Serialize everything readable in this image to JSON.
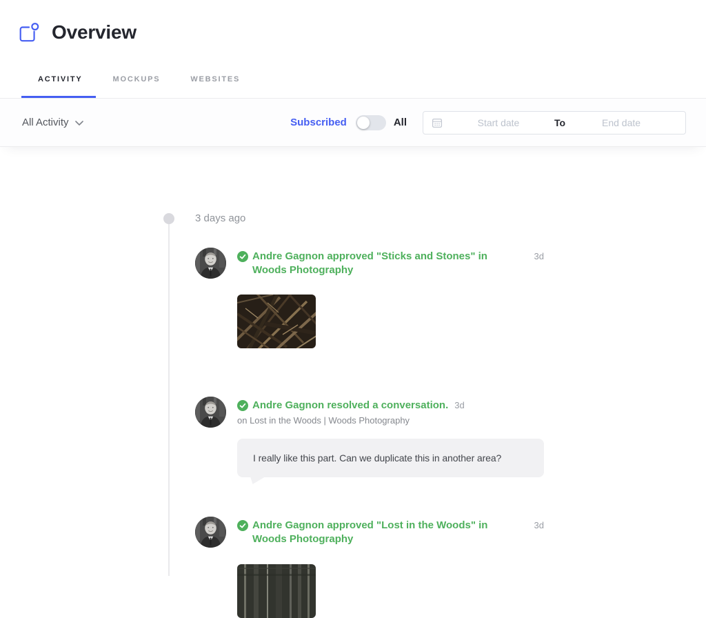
{
  "header": {
    "title": "Overview"
  },
  "tabs": [
    {
      "label": "ACTIVITY",
      "active": true
    },
    {
      "label": "MOCKUPS",
      "active": false
    },
    {
      "label": "WEBSITES",
      "active": false
    }
  ],
  "filter_bar": {
    "activity_filter_label": "All Activity",
    "subscribed_label": "Subscribed",
    "all_label": "All",
    "toggle_position": "left",
    "date_range": {
      "start_placeholder": "Start date",
      "to_label": "To",
      "end_placeholder": "End date"
    }
  },
  "timeline": {
    "group_label": "3 days ago",
    "items": [
      {
        "type": "approval",
        "text": "Andre Gagnon approved \"Sticks and Stones\" in Woods Photography",
        "timestamp": "3d",
        "thumbnail": "sticks-and-stones-photo"
      },
      {
        "type": "conversation-resolved",
        "text": "Andre Gagnon resolved a conversation.",
        "timestamp": "3d",
        "context": "on Lost in the Woods | Woods Photography",
        "comment": "I really like this part. Can we duplicate this in another area?"
      },
      {
        "type": "approval",
        "text": "Andre Gagnon approved \"Lost in the Woods\" in Woods Photography",
        "timestamp": "3d",
        "thumbnail": "lost-in-the-woods-photo"
      }
    ]
  },
  "colors": {
    "accent_blue": "#455ef2",
    "success_green": "#4eb05c",
    "timeline_gray": "#d9d9de",
    "bubble_gray": "#f1f1f3"
  },
  "icons": {
    "header": "overview-mockup-icon",
    "filter": "chevron-down-icon",
    "date": "calendar-icon",
    "status": "check-badge-icon"
  }
}
